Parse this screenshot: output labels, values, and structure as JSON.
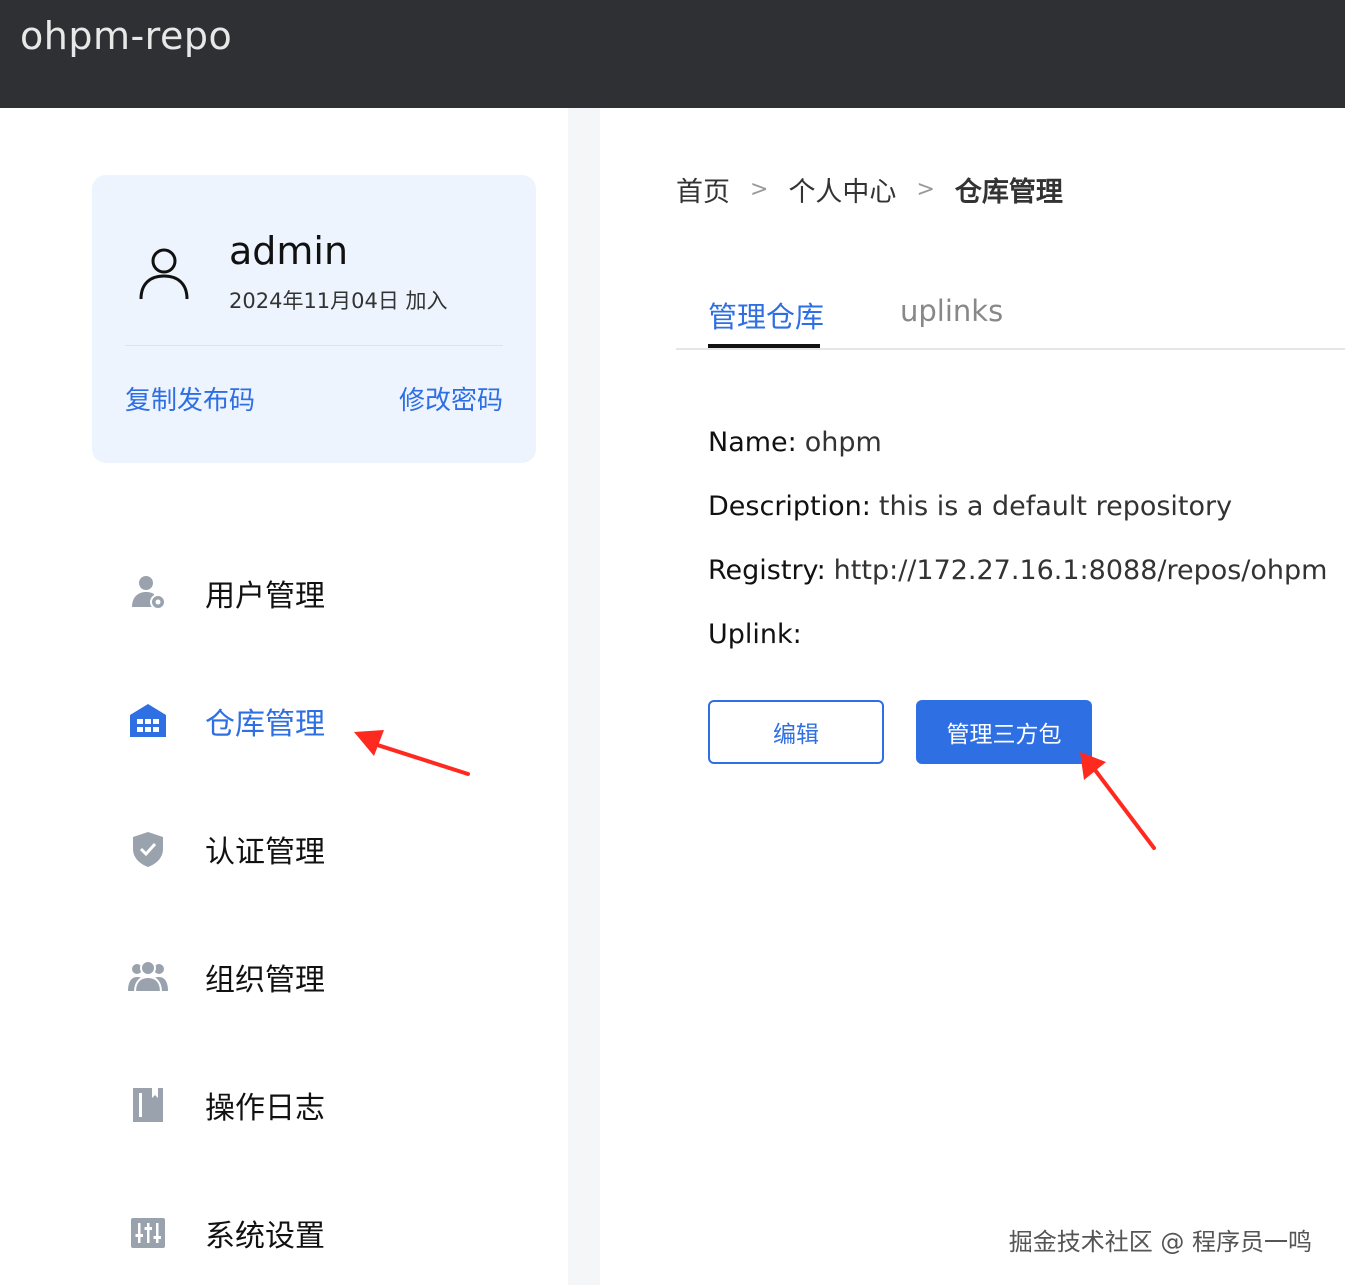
{
  "header": {
    "app_title": "ohpm-repo"
  },
  "profile": {
    "username": "admin",
    "joined": "2024年11月04日 加入",
    "copy_link": "复制发布码",
    "change_password": "修改密码"
  },
  "sidebar": {
    "items": [
      {
        "label": "用户管理",
        "icon": "user-settings-icon"
      },
      {
        "label": "仓库管理",
        "icon": "warehouse-icon",
        "active": true
      },
      {
        "label": "认证管理",
        "icon": "shield-check-icon"
      },
      {
        "label": "组织管理",
        "icon": "group-icon"
      },
      {
        "label": "操作日志",
        "icon": "log-book-icon"
      },
      {
        "label": "系统设置",
        "icon": "sliders-icon"
      }
    ]
  },
  "breadcrumb": {
    "home": "首页",
    "sep": ">",
    "personal": "个人中心",
    "current": "仓库管理"
  },
  "tabs": {
    "manage": "管理仓库",
    "uplinks": "uplinks"
  },
  "repo": {
    "name_label": "Name:",
    "name": "ohpm",
    "description_label": "Description:",
    "description": "this is a default repository",
    "registry_label": "Registry:",
    "registry": "http://172.27.16.1:8088/repos/ohpm",
    "uplink_label": "Uplink:"
  },
  "actions": {
    "edit": "编辑",
    "manage_packages": "管理三方包"
  },
  "watermark": "掘金技术社区 @ 程序员一鸣",
  "colors": {
    "accent": "#2f6fe4",
    "topbar": "#2e3033",
    "card": "#eef4fe",
    "arrow": "#ff2a1f"
  }
}
